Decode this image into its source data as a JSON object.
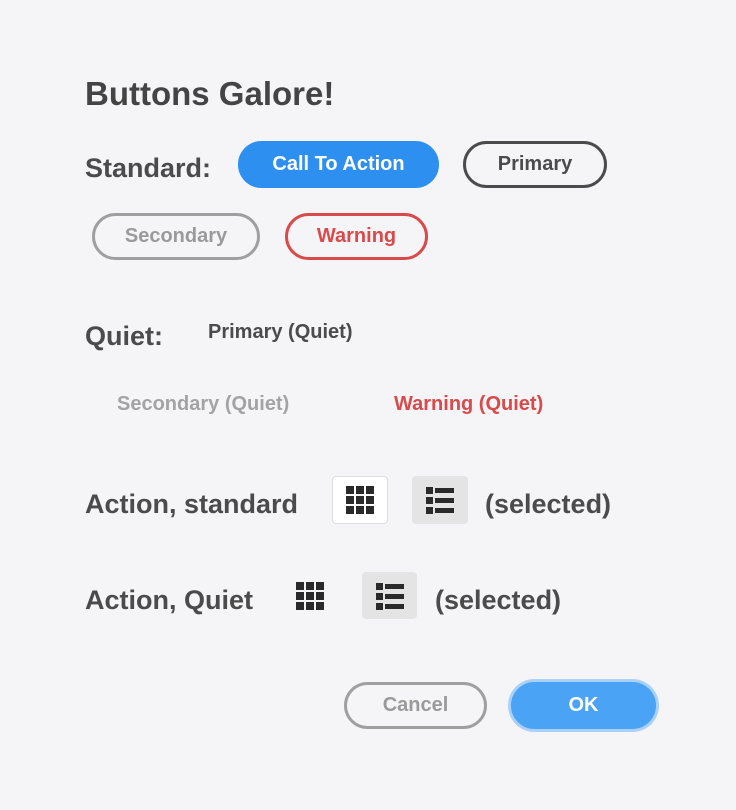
{
  "dialog": {
    "title": "Buttons Galore!"
  },
  "standard": {
    "label": "Standard:",
    "cta": "Call To Action",
    "primary": "Primary",
    "secondary": "Secondary",
    "warning": "Warning"
  },
  "quiet": {
    "label": "Quiet:",
    "primary": "Primary (Quiet)",
    "secondary": "Secondary (Quiet)",
    "warning": "Warning (Quiet)"
  },
  "action_standard": {
    "label": "Action, standard",
    "grid_icon": "grid-view-icon",
    "list_icon": "list-view-icon",
    "selected_note": "(selected)"
  },
  "action_quiet": {
    "label": "Action, Quiet",
    "grid_icon": "grid-view-icon",
    "list_icon": "list-view-icon",
    "selected_note": "(selected)"
  },
  "footer": {
    "cancel": "Cancel",
    "ok": "OK"
  },
  "colors": {
    "accent": "#2d8ff0",
    "warning": "#d94a4a",
    "text": "#4b4b4b",
    "muted": "#9a9a9a",
    "background": "#f5f5f7"
  }
}
